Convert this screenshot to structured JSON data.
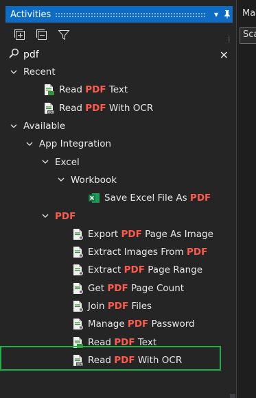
{
  "panel": {
    "title": "Activities",
    "pin_glyph": "❘",
    "dropdown_glyph": "▾"
  },
  "search": {
    "value": "pdf",
    "placeholder": ""
  },
  "highlight_color": "#ff5a4e",
  "tree": [
    {
      "id": "recent",
      "level": 0,
      "expanded": true,
      "parts": [
        {
          "t": "Recent"
        }
      ]
    },
    {
      "id": "recent-read-pdf-text",
      "level": 1,
      "icon": "read-pdf-icon",
      "parts": [
        {
          "t": "Read "
        },
        {
          "t": "PDF",
          "hl": true
        },
        {
          "t": " Text"
        }
      ]
    },
    {
      "id": "recent-read-pdf-ocr",
      "level": 1,
      "icon": "read-pdf-ocr-icon",
      "parts": [
        {
          "t": "Read "
        },
        {
          "t": "PDF",
          "hl": true
        },
        {
          "t": " With OCR"
        }
      ]
    },
    {
      "id": "available",
      "level": 0,
      "expanded": true,
      "parts": [
        {
          "t": "Available"
        }
      ]
    },
    {
      "id": "app-integration",
      "level": 1,
      "expanded": true,
      "parts": [
        {
          "t": "App Integration"
        }
      ]
    },
    {
      "id": "excel",
      "level": 2,
      "expanded": true,
      "parts": [
        {
          "t": "Excel"
        }
      ]
    },
    {
      "id": "workbook",
      "level": 3,
      "expanded": true,
      "parts": [
        {
          "t": "Workbook"
        }
      ]
    },
    {
      "id": "save-excel-as-pdf",
      "level": 4,
      "icon": "excel-icon",
      "parts": [
        {
          "t": "Save Excel File As "
        },
        {
          "t": "PDF",
          "hl": true
        }
      ]
    },
    {
      "id": "pdf-category",
      "level": 2,
      "expanded": true,
      "parts": [
        {
          "t": "PDF",
          "hl": true
        }
      ]
    },
    {
      "id": "export-pdf-page-image",
      "level": 3,
      "icon": "pdf-activity-icon",
      "parts": [
        {
          "t": "Export "
        },
        {
          "t": "PDF",
          "hl": true
        },
        {
          "t": " Page As Image"
        }
      ]
    },
    {
      "id": "extract-images-from-pdf",
      "level": 3,
      "icon": "pdf-activity-icon",
      "parts": [
        {
          "t": "Extract Images From "
        },
        {
          "t": "PDF",
          "hl": true
        }
      ]
    },
    {
      "id": "extract-pdf-page-range",
      "level": 3,
      "icon": "pdf-activity-icon",
      "parts": [
        {
          "t": "Extract "
        },
        {
          "t": "PDF",
          "hl": true
        },
        {
          "t": " Page Range"
        }
      ]
    },
    {
      "id": "get-pdf-page-count",
      "level": 3,
      "icon": "pdf-activity-icon",
      "parts": [
        {
          "t": "Get "
        },
        {
          "t": "PDF",
          "hl": true
        },
        {
          "t": " Page Count"
        }
      ]
    },
    {
      "id": "join-pdf-files",
      "level": 3,
      "icon": "pdf-activity-icon",
      "parts": [
        {
          "t": "Join "
        },
        {
          "t": "PDF",
          "hl": true
        },
        {
          "t": " Files"
        }
      ]
    },
    {
      "id": "manage-pdf-password",
      "level": 3,
      "icon": "pdf-activity-icon",
      "parts": [
        {
          "t": "Manage "
        },
        {
          "t": "PDF",
          "hl": true
        },
        {
          "t": " Password"
        }
      ]
    },
    {
      "id": "read-pdf-text",
      "level": 3,
      "icon": "read-pdf-icon",
      "parts": [
        {
          "t": "Read "
        },
        {
          "t": "PDF",
          "hl": true
        },
        {
          "t": " Text"
        }
      ]
    },
    {
      "id": "read-pdf-with-ocr",
      "level": 3,
      "icon": "read-pdf-ocr-icon",
      "selected": true,
      "parts": [
        {
          "t": "Read "
        },
        {
          "t": "PDF",
          "hl": true
        },
        {
          "t": " With OCR"
        }
      ]
    }
  ],
  "right_pane": {
    "tab_label": "Ma",
    "doc_text": "Sca"
  }
}
